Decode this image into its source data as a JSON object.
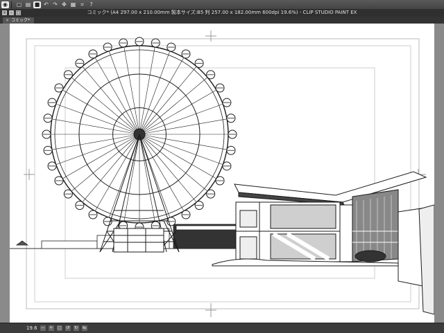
{
  "window": {
    "title": "コミック* (A4 297.00 x 210.00mm 製本サイズ:B5 判 257.00 x 182.00mm 600dpi 19.6%)  - CLIP STUDIO PAINT EX"
  },
  "tabs": [
    {
      "label": "コミック*"
    }
  ],
  "toolbar": {
    "icons": [
      "app-menu-icon",
      "new-icon",
      "open-icon",
      "save-icon",
      "undo-icon",
      "redo-icon",
      "transform-icon",
      "ruler-icon",
      "snap-icon",
      "help-icon"
    ]
  },
  "status": {
    "zoom": "19.6"
  },
  "colors": {
    "chrome": "#3a3a3a",
    "canvas_bg": "#8a8a8a",
    "paper": "#ffffff",
    "line": "#222222"
  }
}
